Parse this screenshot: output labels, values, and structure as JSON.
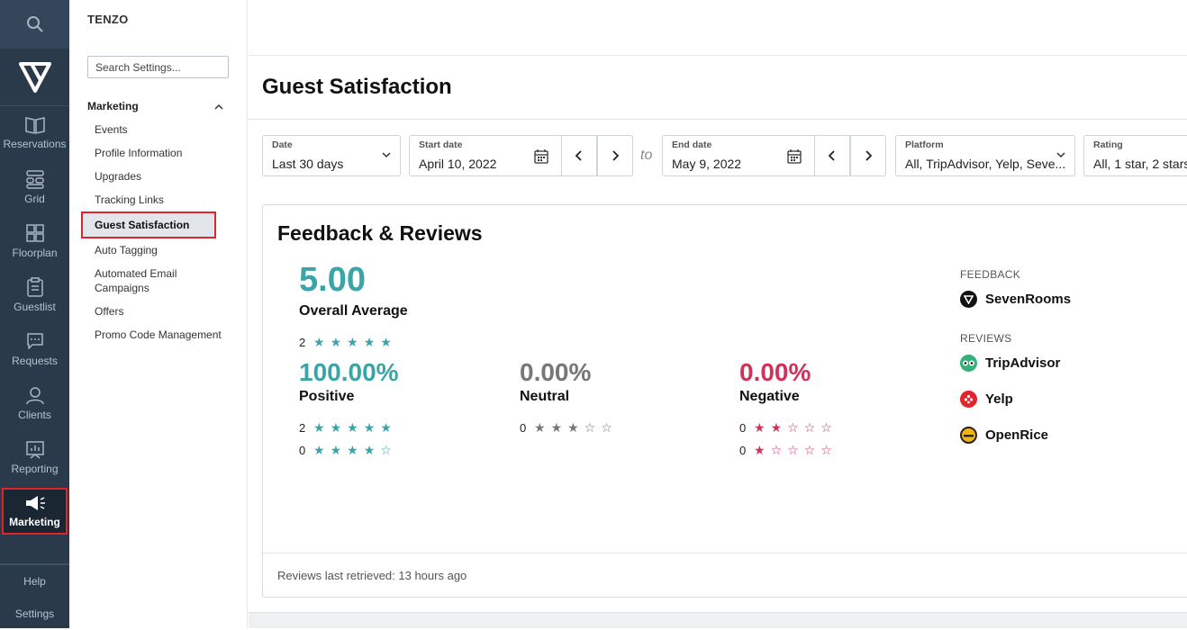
{
  "nav": {
    "items": [
      {
        "label": "Reservations",
        "icon": "book-icon"
      },
      {
        "label": "Grid",
        "icon": "grid-icon"
      },
      {
        "label": "Floorplan",
        "icon": "floorplan-icon"
      },
      {
        "label": "Guestlist",
        "icon": "clipboard-icon"
      },
      {
        "label": "Requests",
        "icon": "chat-icon"
      },
      {
        "label": "Clients",
        "icon": "users-icon"
      },
      {
        "label": "Reporting",
        "icon": "chart-icon"
      },
      {
        "label": "Marketing",
        "icon": "megaphone-icon"
      }
    ],
    "help": "Help",
    "settings": "Settings"
  },
  "sidebar": {
    "brand": "TENZO",
    "search_placeholder": "Search Settings...",
    "section": "Marketing",
    "items": [
      "Events",
      "Profile Information",
      "Upgrades",
      "Tracking Links",
      "Guest Satisfaction",
      "Auto Tagging",
      "Automated Email Campaigns",
      "Offers",
      "Promo Code Management"
    ]
  },
  "page": {
    "title": "Guest Satisfaction"
  },
  "filters": {
    "date": {
      "label": "Date",
      "value": "Last 30 days"
    },
    "start": {
      "label": "Start date",
      "value": "April 10, 2022"
    },
    "to": "to",
    "end": {
      "label": "End date",
      "value": "May 9, 2022"
    },
    "platform": {
      "label": "Platform",
      "value": "All, TripAdvisor, Yelp, Seve..."
    },
    "rating": {
      "label": "Rating",
      "value": "All, 1 star, 2 stars"
    }
  },
  "card": {
    "title": "Feedback & Reviews",
    "average": "5.00",
    "average_label": "Overall Average",
    "average_count": "2",
    "positive": {
      "value": "100.00%",
      "label": "Positive",
      "rows": [
        {
          "count": "2",
          "stars": 5
        },
        {
          "count": "0",
          "stars": 4
        }
      ]
    },
    "neutral": {
      "value": "0.00%",
      "label": "Neutral",
      "rows": [
        {
          "count": "0",
          "stars": 3
        }
      ]
    },
    "negative": {
      "value": "0.00%",
      "label": "Negative",
      "rows": [
        {
          "count": "0",
          "stars": 2
        },
        {
          "count": "0",
          "stars": 1
        }
      ]
    },
    "feedback_head": "FEEDBACK",
    "reviews_head": "REVIEWS",
    "platforms": {
      "sevenrooms": "SevenRooms",
      "tripadvisor": "TripAdvisor",
      "yelp": "Yelp",
      "openrice": "OpenRice"
    },
    "retrieved": "Reviews last retrieved: 13 hours ago"
  },
  "colors": {
    "positive": "#3aa5a8",
    "neutral": "#777777",
    "negative": "#d2325a",
    "nav_bg": "#2b3a4a",
    "highlight": "#e0232c"
  }
}
